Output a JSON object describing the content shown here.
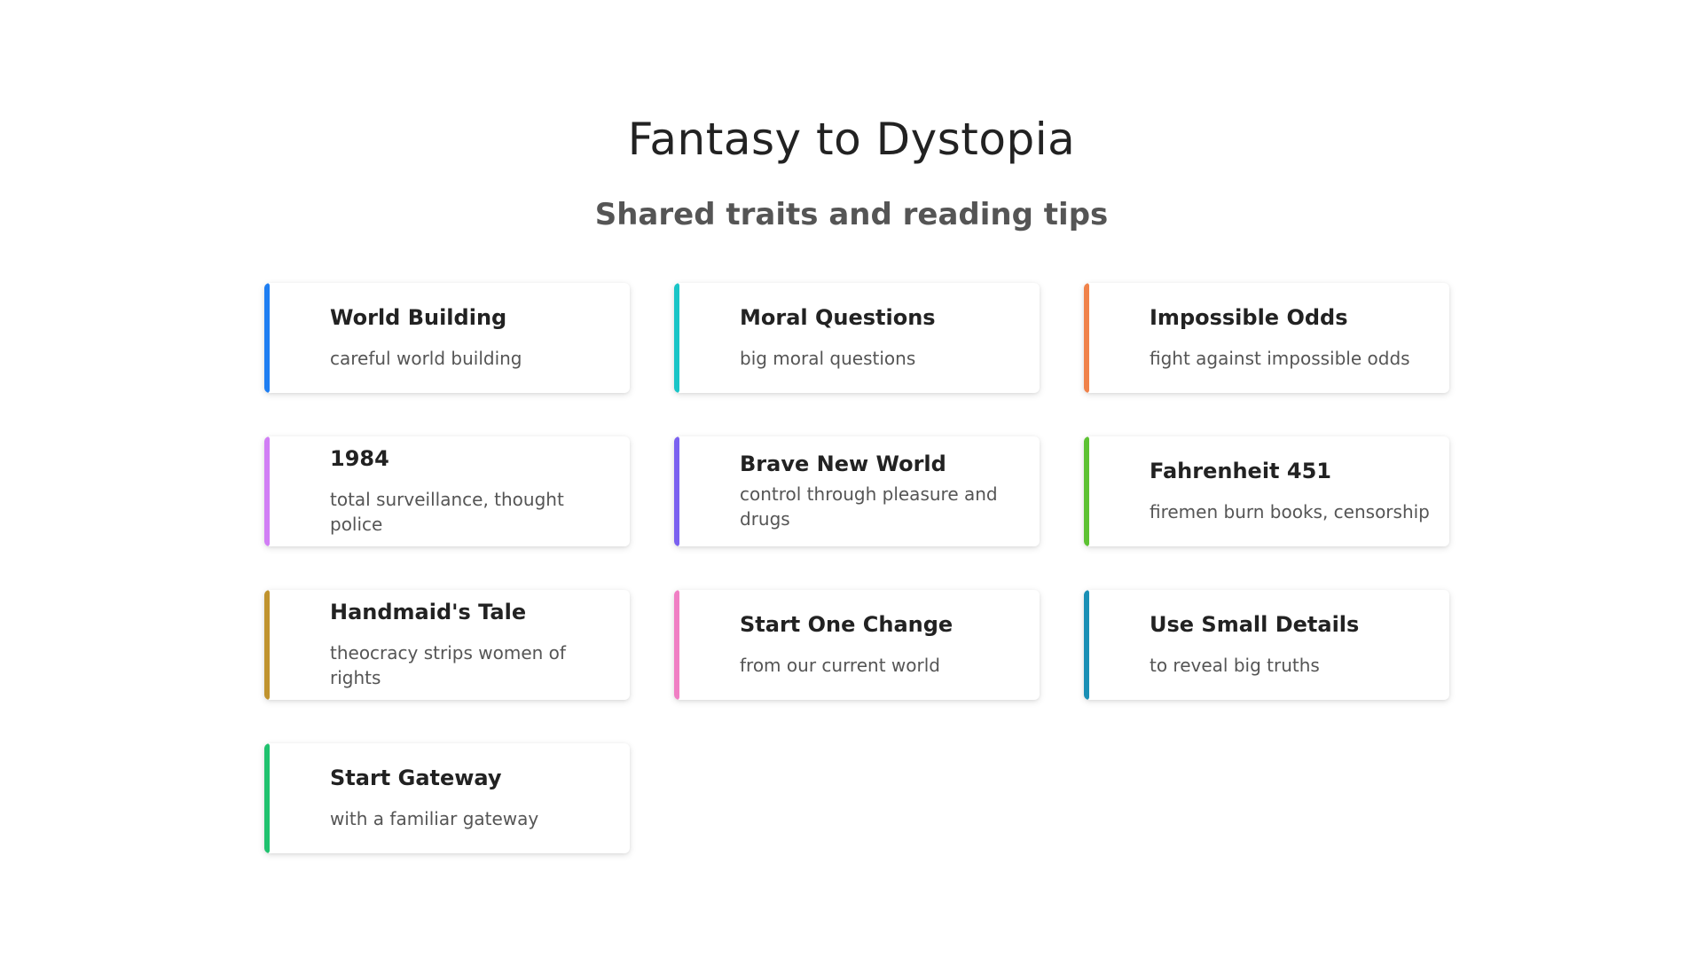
{
  "header": {
    "title": "Fantasy to Dystopia",
    "subtitle": "Shared traits and reading tips"
  },
  "cards": [
    {
      "title": "World Building",
      "desc": "careful world building",
      "color": "#1e7ef2"
    },
    {
      "title": "Moral Questions",
      "desc": "big moral questions",
      "color": "#19c5c7"
    },
    {
      "title": "Impossible Odds",
      "desc": "fight against impossible odds",
      "color": "#f0824a"
    },
    {
      "title": "1984",
      "desc": "total surveillance, thought police",
      "color": "#d17ef5"
    },
    {
      "title": "Brave New World",
      "desc": "control through pleasure and drugs",
      "color": "#7b61f0"
    },
    {
      "title": "Fahrenheit 451",
      "desc": "firemen burn books, censorship",
      "color": "#5dc233"
    },
    {
      "title": "Handmaid's Tale",
      "desc": "theocracy strips women of rights",
      "color": "#c0932e"
    },
    {
      "title": "Start One Change",
      "desc": "from our current world",
      "color": "#f07fc4"
    },
    {
      "title": "Use Small Details",
      "desc": "to reveal big truths",
      "color": "#1a8fb5"
    },
    {
      "title": "Start Gateway",
      "desc": "with a familiar gateway",
      "color": "#1fc26e"
    }
  ]
}
